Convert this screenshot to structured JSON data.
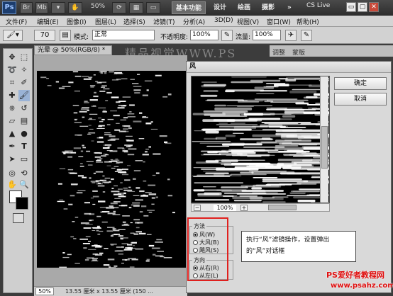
{
  "app": {
    "logo": "Ps",
    "zoom": "50%",
    "workspaces": [
      "基本功能",
      "设计",
      "绘画",
      "摄影"
    ],
    "more": "»",
    "cs_live": "CS Live",
    "window_controls": [
      "▭",
      "▢",
      "✕"
    ]
  },
  "menu": [
    "文件(F)",
    "编辑(E)",
    "图像(I)",
    "图层(L)",
    "选择(S)",
    "滤镜(T)",
    "分析(A)",
    "3D(D)",
    "视图(V)",
    "窗口(W)",
    "帮助(H)"
  ],
  "options": {
    "brush_size": "70",
    "mode_label": "模式:",
    "mode_value": "正常",
    "opacity_label": "不透明度:",
    "opacity_value": "100%",
    "flow_label": "流量:",
    "flow_value": "100%"
  },
  "document": {
    "tab_title": "光晕 @ 50%(RGB/8) *",
    "zoom": "50%",
    "size_info": "13.55 厘米 x 13.55 厘米 (150 ..."
  },
  "panels": {
    "tabs": [
      "调整",
      "蒙版"
    ]
  },
  "dialog": {
    "title": "风",
    "ok": "确定",
    "cancel": "取消",
    "preview_zoom": "100%",
    "minus": "−",
    "plus": "+",
    "method_title": "方法",
    "method_options": [
      "风(W)",
      "大风(B)",
      "飓风(S)"
    ],
    "direction_title": "方向",
    "direction_options": [
      "从右(R)",
      "从左(L)"
    ]
  },
  "annotation": "执行“风”滤镜操作，设置弹出的“风”对话框",
  "watermark": "精品视觉WWW.PS",
  "site": {
    "logo": "PS爱好者教程网",
    "url": "www.psahz.com"
  }
}
